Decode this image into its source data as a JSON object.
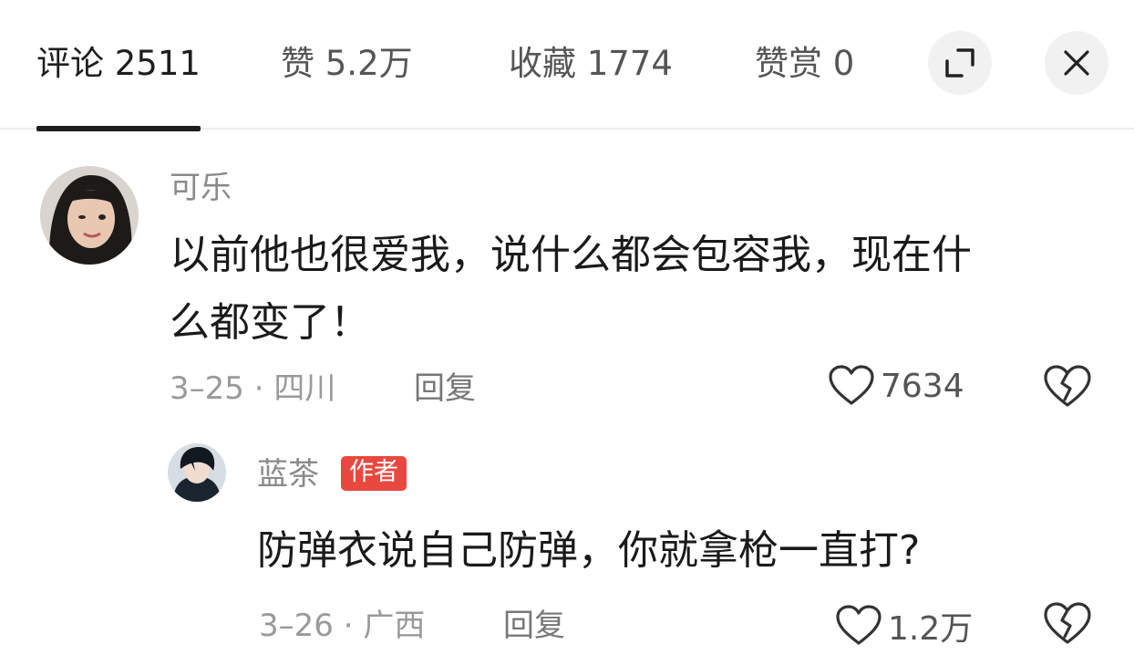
{
  "tabs": [
    {
      "label": "评论 2511"
    },
    {
      "label": "赞 5.2万"
    },
    {
      "label": "收藏 1774"
    },
    {
      "label": "赞赏 0"
    }
  ],
  "icons": {
    "expand": "expand-icon",
    "close": "close-icon",
    "like": "heart-icon",
    "dislike": "broken-heart-icon"
  },
  "comment": {
    "username": "可乐",
    "text_line1": "以前他也很爱我，说什么都会包容我，现在什",
    "text_line2": "么都变了！",
    "date_location": "3–25 · 四川",
    "reply_label": "回复",
    "likes": "7634"
  },
  "reply": {
    "username": "蓝茶",
    "badge": "作者",
    "text": "防弹衣说自己防弹，你就拿枪一直打?",
    "date_location": "3–26 · 广西",
    "reply_label": "回复",
    "likes": "1.2万"
  },
  "colors": {
    "badge": "#e8483f",
    "active_tab": "#1e1e1e",
    "muted": "#9a9a9a"
  }
}
